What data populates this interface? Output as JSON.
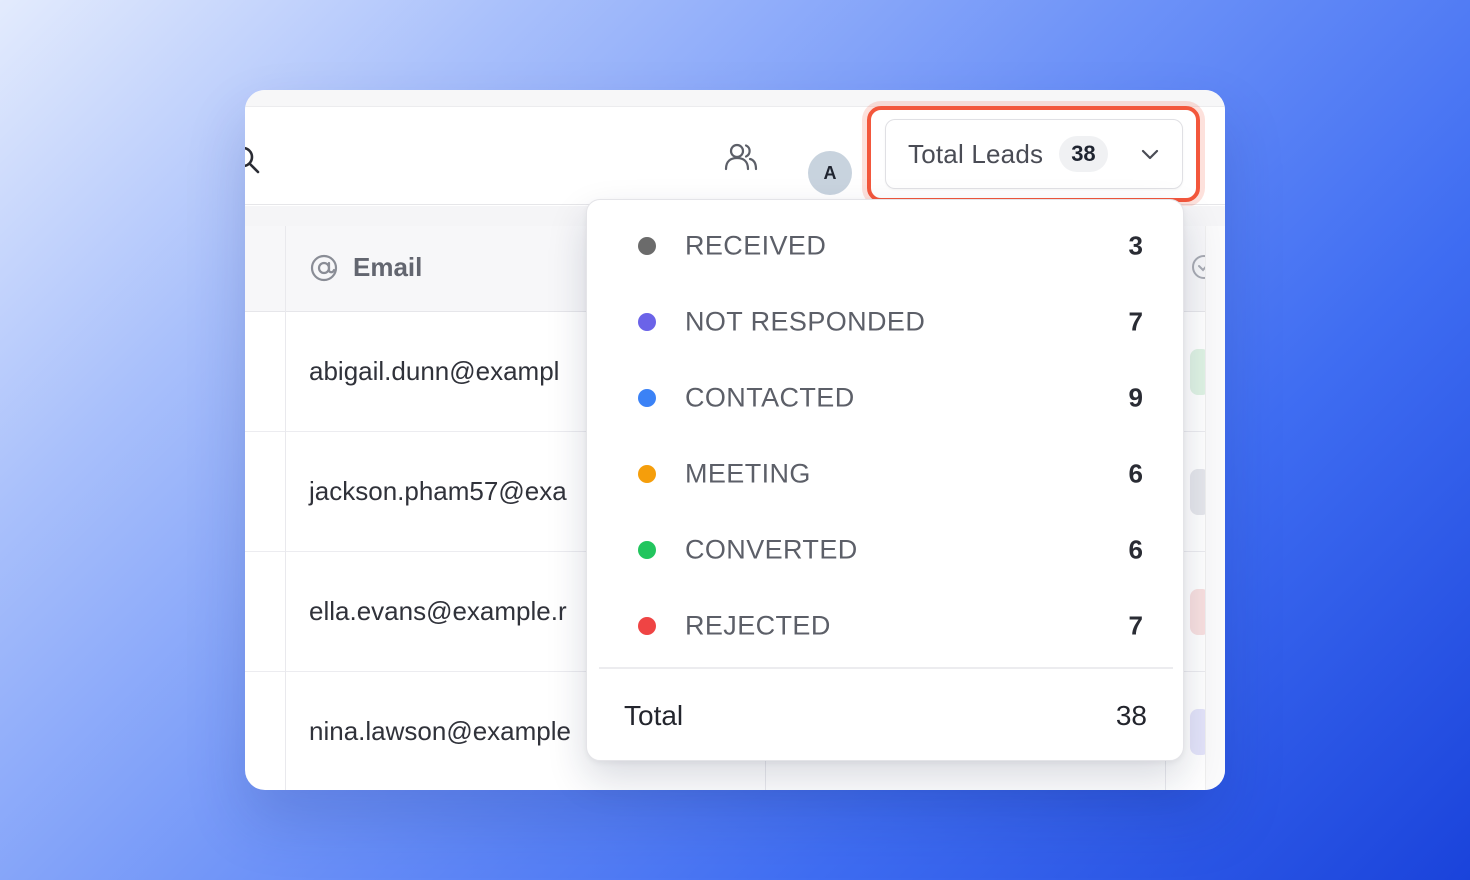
{
  "header": {
    "total_leads_label": "Total Leads",
    "total_leads_count": "38",
    "avatar_initial": "A"
  },
  "table": {
    "columns": [
      {
        "label": "Email",
        "icon": "at-sign-icon"
      }
    ],
    "rows": [
      {
        "email": "abigail.dunn@exampl",
        "status_color": "#dff3e4"
      },
      {
        "email": "jackson.pham57@exa",
        "status_color": "#e6e7ec"
      },
      {
        "email": "ella.evans@example.r",
        "status_color": "#f9e0e0"
      },
      {
        "email": "nina.lawson@example",
        "status_color": "#e4e4fa"
      }
    ]
  },
  "dropdown": {
    "statuses": [
      {
        "label": "RECEIVED",
        "count": "3",
        "color": "#6b6b6b"
      },
      {
        "label": "NOT RESPONDED",
        "count": "7",
        "color": "#6b63e8"
      },
      {
        "label": "CONTACTED",
        "count": "9",
        "color": "#3b82f6"
      },
      {
        "label": "MEETING",
        "count": "6",
        "color": "#f59e0b"
      },
      {
        "label": "CONVERTED",
        "count": "6",
        "color": "#22c55e"
      },
      {
        "label": "REJECTED",
        "count": "7",
        "color": "#ef4444"
      }
    ],
    "total_label": "Total",
    "total_count": "38"
  },
  "colors": {
    "highlight": "#f3573c"
  }
}
